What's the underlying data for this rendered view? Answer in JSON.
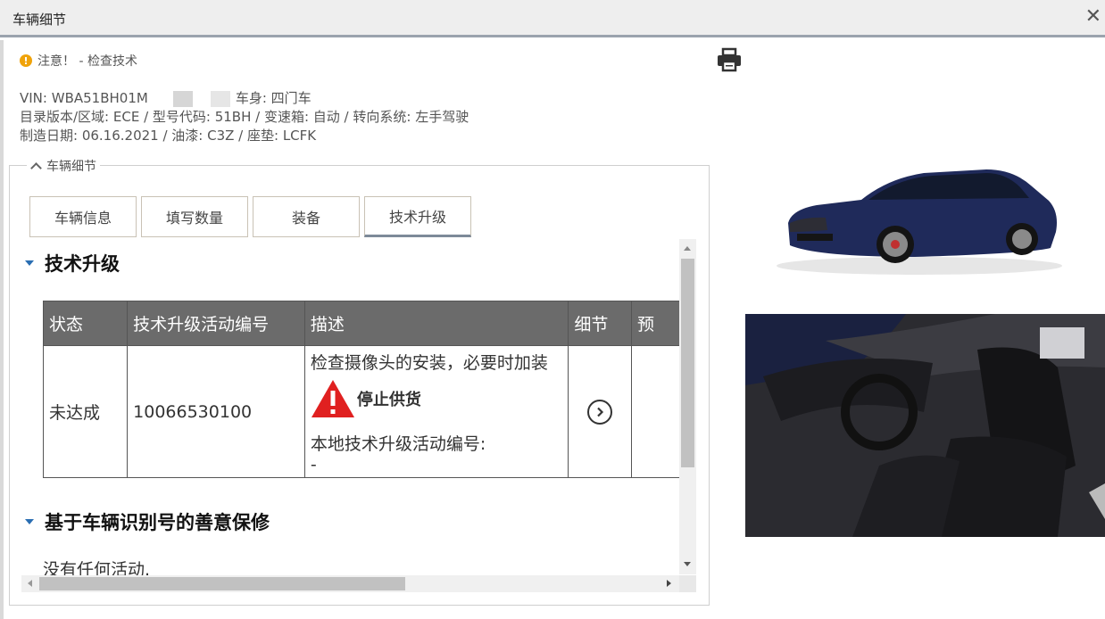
{
  "window": {
    "title": "车辆细节"
  },
  "notice": {
    "icon": "!",
    "text": "注意！ - 检查技术"
  },
  "vehicle": {
    "line1_vin_label": "VIN:",
    "line1_vin_value": "WBA51BH01M",
    "line1_body": "车身:  四门车",
    "line2": "目录版本/区域:  ECE / 型号代码:  51BH / 变速箱:  自动 / 转向系统:  左手驾驶",
    "line3": "制造日期:  06.16.2021 / 油漆: C3Z / 座垫: LCFK"
  },
  "panel": {
    "legend": "车辆细节"
  },
  "tabs": [
    {
      "label": "车辆信息"
    },
    {
      "label": "填写数量"
    },
    {
      "label": "装备"
    },
    {
      "label": "技术升级"
    }
  ],
  "active_tab": "技术升级",
  "section1": {
    "heading": "技术升级"
  },
  "table": {
    "headers": [
      "状态",
      "技术升级活动编号",
      "描述",
      "细节",
      "预"
    ],
    "rows": [
      {
        "status": "未达成",
        "campaign_no": "10066530100",
        "desc_line1": "检查摄像头的安装，必要时加装",
        "stop_label": "停止供货",
        "local_label": "本地技术升级活动编号:",
        "local_value": "-"
      }
    ]
  },
  "section2": {
    "heading": "基于车辆识别号的善意保修"
  },
  "no_activity": "没有任何活动.",
  "icons": {
    "warning": "warning-triangle-icon",
    "print": "printer-icon",
    "detail": "chevron-right-circle-icon"
  },
  "colors": {
    "header_bg": "#6b6b6b",
    "warn": "#e02020",
    "notice": "#f0a30a",
    "accent": "#2a6eb2",
    "car": "#1f2a5a"
  }
}
